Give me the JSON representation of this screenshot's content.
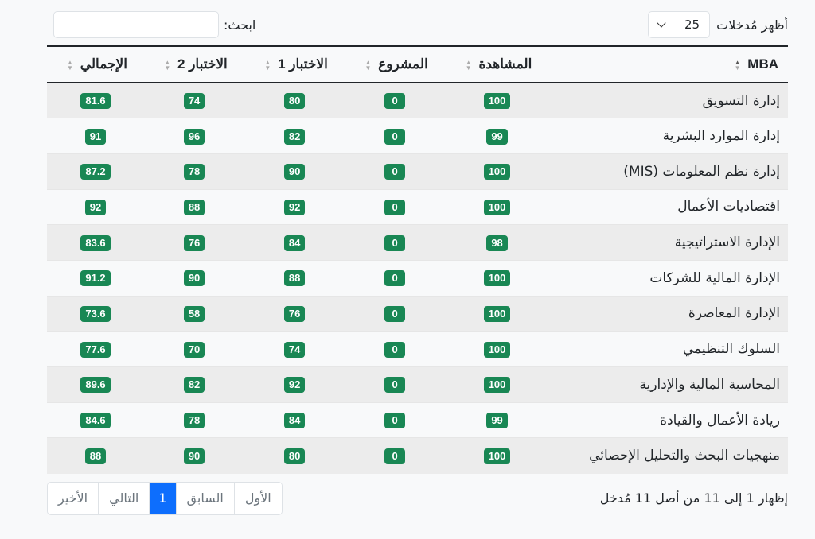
{
  "controls": {
    "length_label": "أظهر مُدخلات",
    "length_value": "25",
    "search_label": "ابحث:",
    "search_value": ""
  },
  "columns": [
    "MBA",
    "المشاهدة",
    "المشروع",
    "الاختبار 1",
    "الاختبار 2",
    "الإجمالي"
  ],
  "rows": [
    {
      "course": "إدارة التسويق",
      "watch": "100",
      "project": "0",
      "test1": "80",
      "test2": "74",
      "total": "81.6"
    },
    {
      "course": "إدارة الموارد البشرية",
      "watch": "99",
      "project": "0",
      "test1": "82",
      "test2": "96",
      "total": "91"
    },
    {
      "course": "إدارة نظم المعلومات (MIS)",
      "watch": "100",
      "project": "0",
      "test1": "90",
      "test2": "78",
      "total": "87.2"
    },
    {
      "course": "اقتصاديات الأعمال",
      "watch": "100",
      "project": "0",
      "test1": "92",
      "test2": "88",
      "total": "92"
    },
    {
      "course": "الإدارة الاستراتيجية",
      "watch": "98",
      "project": "0",
      "test1": "84",
      "test2": "76",
      "total": "83.6"
    },
    {
      "course": "الإدارة المالية للشركات",
      "watch": "100",
      "project": "0",
      "test1": "88",
      "test2": "90",
      "total": "91.2"
    },
    {
      "course": "الإدارة المعاصرة",
      "watch": "100",
      "project": "0",
      "test1": "76",
      "test2": "58",
      "total": "73.6"
    },
    {
      "course": "السلوك التنظيمي",
      "watch": "100",
      "project": "0",
      "test1": "74",
      "test2": "70",
      "total": "77.6"
    },
    {
      "course": "المحاسبة المالية والإدارية",
      "watch": "100",
      "project": "0",
      "test1": "92",
      "test2": "82",
      "total": "89.6"
    },
    {
      "course": "ريادة الأعمال والقيادة",
      "watch": "99",
      "project": "0",
      "test1": "84",
      "test2": "78",
      "total": "84.6"
    },
    {
      "course": "منهجيات البحث والتحليل الإحصائي",
      "watch": "100",
      "project": "0",
      "test1": "80",
      "test2": "90",
      "total": "88"
    }
  ],
  "footer": {
    "info": "إظهار 1 إلى 11 من أصل 11 مُدخل",
    "pager": {
      "first": "الأول",
      "prev": "السابق",
      "current": "1",
      "next": "التالي",
      "last": "الأخير"
    }
  },
  "colors": {
    "badge": "#198754",
    "active_page": "#0d6efd"
  }
}
